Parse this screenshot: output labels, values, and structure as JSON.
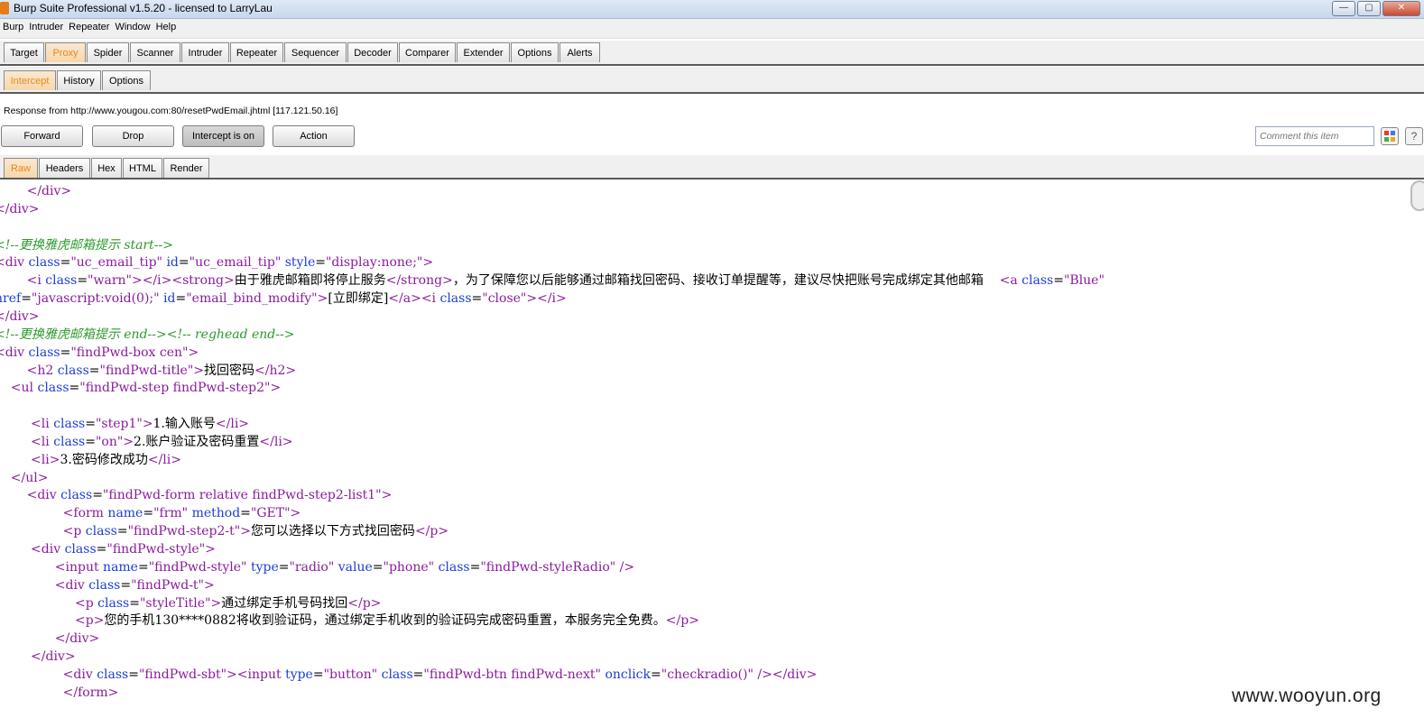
{
  "window": {
    "title": "Burp Suite Professional v1.5.20 - licensed to LarryLau",
    "buttons": [
      "—",
      "▢",
      "✕"
    ]
  },
  "menu": [
    "Burp",
    "Intruder",
    "Repeater",
    "Window",
    "Help"
  ],
  "main_tabs": [
    "Target",
    "Proxy",
    "Spider",
    "Scanner",
    "Intruder",
    "Repeater",
    "Sequencer",
    "Decoder",
    "Comparer",
    "Extender",
    "Options",
    "Alerts"
  ],
  "main_tab_active": "Proxy",
  "proxy_tabs": [
    "Intercept",
    "History",
    "Options"
  ],
  "proxy_tab_active": "Intercept",
  "response_line": "Response from http://www.yougou.com:80/resetPwdEmail.jhtml  [117.121.50.16]",
  "actions": {
    "forward": "Forward",
    "drop": "Drop",
    "intercept": "Intercept is on",
    "action": "Action"
  },
  "comment_placeholder": "Comment this item",
  "view_tabs": [
    "Raw",
    "Headers",
    "Hex",
    "HTML",
    "Render"
  ],
  "view_tab_active": "Raw",
  "icons": {
    "app": "burp-logo-icon",
    "color": "color-grid-icon",
    "help": "help-icon"
  },
  "watermark": "www.wooyun.org",
  "code_lines": [
    [
      [
        "tg",
        "        </div>"
      ]
    ],
    [
      [
        "tg",
        "</div>"
      ]
    ],
    [],
    [
      [
        "cm",
        "<!--更换雅虎邮箱提示 start-->"
      ]
    ],
    [
      [
        "tg",
        "<div "
      ],
      [
        "at",
        "class"
      ],
      [
        "tx",
        "="
      ],
      [
        "vl",
        "\"uc_email_tip\""
      ],
      [
        "tx",
        " "
      ],
      [
        "at",
        "id"
      ],
      [
        "tx",
        "="
      ],
      [
        "vl",
        "\"uc_email_tip\""
      ],
      [
        "tx",
        " "
      ],
      [
        "at",
        "style"
      ],
      [
        "tx",
        "="
      ],
      [
        "vl",
        "\"display:none;\""
      ],
      [
        "tg",
        ">"
      ]
    ],
    [
      [
        "tg",
        "        <i "
      ],
      [
        "at",
        "class"
      ],
      [
        "tx",
        "="
      ],
      [
        "vl",
        "\"warn\""
      ],
      [
        "tg",
        "></i><strong>"
      ],
      [
        "tx",
        "由于雅虎邮箱即将停止服务"
      ],
      [
        "tg",
        "</strong>"
      ],
      [
        "tx",
        "，为了保障您以后能够通过邮箱找回密码、接收订单提醒等，建议尽快把账号完成绑定其他邮箱    "
      ],
      [
        "tg",
        "<a "
      ],
      [
        "at",
        "class"
      ],
      [
        "tx",
        "="
      ],
      [
        "vl",
        "\"Blue\""
      ]
    ],
    [
      [
        "at",
        "href"
      ],
      [
        "tx",
        "="
      ],
      [
        "vl",
        "\"javascript:void(0);\""
      ],
      [
        "tx",
        " "
      ],
      [
        "at",
        "id"
      ],
      [
        "tx",
        "="
      ],
      [
        "vl",
        "\"email_bind_modify\""
      ],
      [
        "tg",
        ">"
      ],
      [
        "tx",
        "[立即绑定]"
      ],
      [
        "tg",
        "</a><i "
      ],
      [
        "at",
        "class"
      ],
      [
        "tx",
        "="
      ],
      [
        "vl",
        "\"close\""
      ],
      [
        "tg",
        "></i>"
      ]
    ],
    [
      [
        "tg",
        "</div>"
      ]
    ],
    [
      [
        "cm",
        "<!--更换雅虎邮箱提示 end--><!-- reghead end-->"
      ]
    ],
    [
      [
        "tg",
        "<div "
      ],
      [
        "at",
        "class"
      ],
      [
        "tx",
        "="
      ],
      [
        "vl",
        "\"findPwd-box cen\""
      ],
      [
        "tg",
        ">"
      ]
    ],
    [
      [
        "tg",
        "        <h2 "
      ],
      [
        "at",
        "class"
      ],
      [
        "tx",
        "="
      ],
      [
        "vl",
        "\"findPwd-title\""
      ],
      [
        "tg",
        ">"
      ],
      [
        "tx",
        "找回密码"
      ],
      [
        "tg",
        "</h2>"
      ]
    ],
    [
      [
        "tg",
        "    <ul "
      ],
      [
        "at",
        "class"
      ],
      [
        "tx",
        "="
      ],
      [
        "vl",
        "\"findPwd-step findPwd-step2\""
      ],
      [
        "tg",
        ">"
      ]
    ],
    [],
    [
      [
        "tg",
        "         <li "
      ],
      [
        "at",
        "class"
      ],
      [
        "tx",
        "="
      ],
      [
        "vl",
        "\"step1\""
      ],
      [
        "tg",
        ">"
      ],
      [
        "tx",
        "1.输入账号"
      ],
      [
        "tg",
        "</li>"
      ]
    ],
    [
      [
        "tg",
        "         <li "
      ],
      [
        "at",
        "class"
      ],
      [
        "tx",
        "="
      ],
      [
        "vl",
        "\"on\""
      ],
      [
        "tg",
        ">"
      ],
      [
        "tx",
        "2.账户验证及密码重置"
      ],
      [
        "tg",
        "</li>"
      ]
    ],
    [
      [
        "tg",
        "         <li>"
      ],
      [
        "tx",
        "3.密码修改成功"
      ],
      [
        "tg",
        "</li>"
      ]
    ],
    [
      [
        "tg",
        "    </ul>"
      ]
    ],
    [
      [
        "tg",
        "        <div "
      ],
      [
        "at",
        "class"
      ],
      [
        "tx",
        "="
      ],
      [
        "vl",
        "\"findPwd-form relative findPwd-step2-list1\""
      ],
      [
        "tg",
        ">"
      ]
    ],
    [
      [
        "tg",
        "                 <form "
      ],
      [
        "at",
        "name"
      ],
      [
        "tx",
        "="
      ],
      [
        "vl",
        "\"frm\""
      ],
      [
        "tx",
        " "
      ],
      [
        "at",
        "method"
      ],
      [
        "tx",
        "="
      ],
      [
        "vl",
        "\"GET\""
      ],
      [
        "tg",
        ">"
      ]
    ],
    [
      [
        "tg",
        "                 <p "
      ],
      [
        "at",
        "class"
      ],
      [
        "tx",
        "="
      ],
      [
        "vl",
        "\"findPwd-step2-t\""
      ],
      [
        "tg",
        ">"
      ],
      [
        "tx",
        "您可以选择以下方式找回密码"
      ],
      [
        "tg",
        "</p>"
      ]
    ],
    [
      [
        "tg",
        "         <div "
      ],
      [
        "at",
        "class"
      ],
      [
        "tx",
        "="
      ],
      [
        "vl",
        "\"findPwd-style\""
      ],
      [
        "tg",
        ">"
      ]
    ],
    [
      [
        "tg",
        "               <input "
      ],
      [
        "at",
        "name"
      ],
      [
        "tx",
        "="
      ],
      [
        "vl",
        "\"findPwd-style\""
      ],
      [
        "tx",
        " "
      ],
      [
        "at",
        "type"
      ],
      [
        "tx",
        "="
      ],
      [
        "vl",
        "\"radio\""
      ],
      [
        "tx",
        " "
      ],
      [
        "at",
        "value"
      ],
      [
        "tx",
        "="
      ],
      [
        "vl",
        "\"phone\""
      ],
      [
        "tx",
        " "
      ],
      [
        "at",
        "class"
      ],
      [
        "tx",
        "="
      ],
      [
        "vl",
        "\"findPwd-styleRadio\""
      ],
      [
        "tx",
        " "
      ],
      [
        "tg",
        "/>"
      ]
    ],
    [
      [
        "tg",
        "               <div "
      ],
      [
        "at",
        "class"
      ],
      [
        "tx",
        "="
      ],
      [
        "vl",
        "\"findPwd-t\""
      ],
      [
        "tg",
        ">"
      ]
    ],
    [
      [
        "tg",
        "                    <p "
      ],
      [
        "at",
        "class"
      ],
      [
        "tx",
        "="
      ],
      [
        "vl",
        "\"styleTitle\""
      ],
      [
        "tg",
        ">"
      ],
      [
        "tx",
        "通过绑定手机号码找回"
      ],
      [
        "tg",
        "</p>"
      ]
    ],
    [
      [
        "tg",
        "                    <p>"
      ],
      [
        "tx",
        "您的手机130****0882将收到验证码，通过绑定手机收到的验证码完成密码重置，本服务完全免费。"
      ],
      [
        "tg",
        "</p>"
      ]
    ],
    [
      [
        "tg",
        "               </div>"
      ]
    ],
    [
      [
        "tg",
        "         </div>"
      ]
    ],
    [
      [
        "tg",
        "                 <div "
      ],
      [
        "at",
        "class"
      ],
      [
        "tx",
        "="
      ],
      [
        "vl",
        "\"findPwd-sbt\""
      ],
      [
        "tg",
        "><input "
      ],
      [
        "at",
        "type"
      ],
      [
        "tx",
        "="
      ],
      [
        "vl",
        "\"button\""
      ],
      [
        "tx",
        " "
      ],
      [
        "at",
        "class"
      ],
      [
        "tx",
        "="
      ],
      [
        "vl",
        "\"findPwd-btn findPwd-next\""
      ],
      [
        "tx",
        " "
      ],
      [
        "at",
        "onclick"
      ],
      [
        "tx",
        "="
      ],
      [
        "vl",
        "\"checkradio()\""
      ],
      [
        "tx",
        " "
      ],
      [
        "tg",
        "/></div>"
      ]
    ],
    [
      [
        "tg",
        "                 </form>"
      ]
    ]
  ]
}
